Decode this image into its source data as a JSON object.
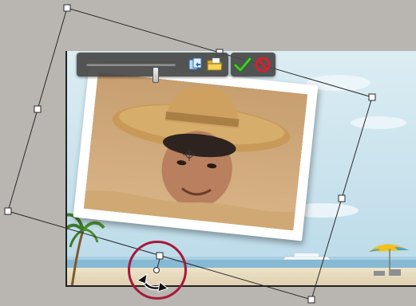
{
  "workspace": {
    "background_color": "#b9b5b1",
    "selection_color": "#222222",
    "highlight_color": "#a6193a"
  },
  "toolbar": {
    "slider_label": "",
    "slider_value": 0.8,
    "buttons": [
      {
        "name": "replace-photo",
        "icon": "replace-photo-icon"
      },
      {
        "name": "open-folder",
        "icon": "folder-icon"
      }
    ]
  },
  "confirm_bar": {
    "commit_icon": "checkmark-icon",
    "cancel_icon": "cancel-icon",
    "commit_color": "#3cae2a",
    "cancel_color": "#d6202e"
  },
  "image_content": {
    "sky_color": "#cfe6f0",
    "sea_color": "#7fb6d4",
    "sand_color": "#e9ddc0"
  }
}
